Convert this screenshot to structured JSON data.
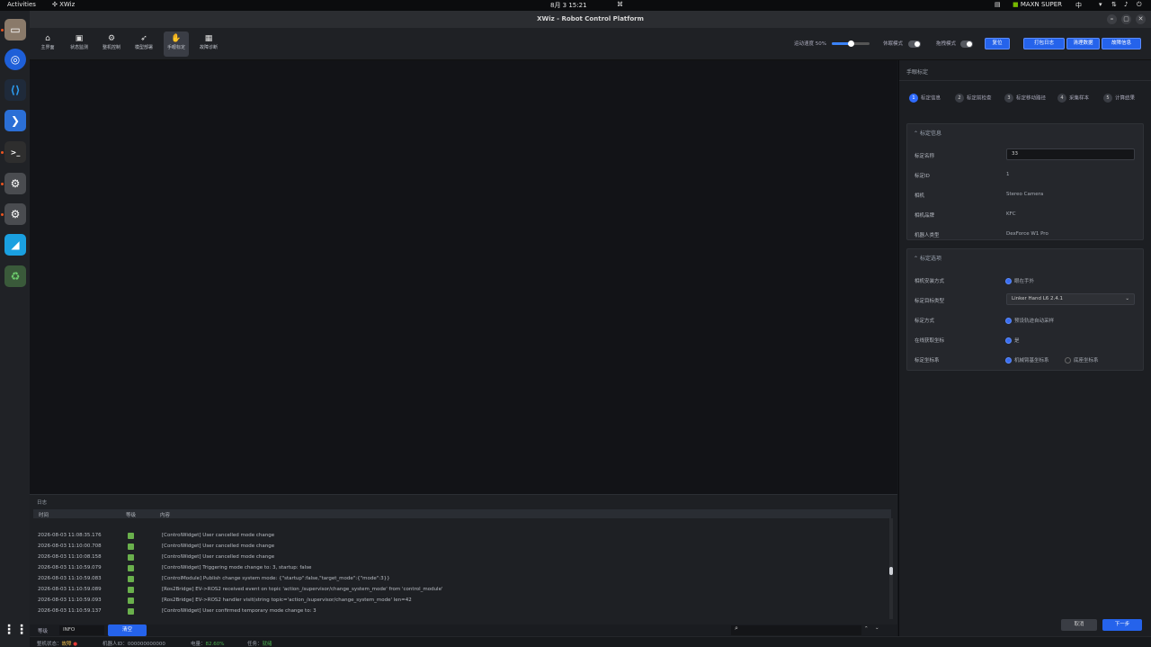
{
  "topbar": {
    "activities": "Activities",
    "app": "XWiz",
    "datetime": "8月 3  15:21",
    "gpu": "MAXN SUPER",
    "lang": "中"
  },
  "window": {
    "title": "XWiz - Robot Control Platform"
  },
  "toolbar": {
    "tools": [
      {
        "label": "主界面",
        "icon": "home-icon"
      },
      {
        "label": "状态监测",
        "icon": "monitor-icon"
      },
      {
        "label": "整机控制",
        "icon": "robot-icon"
      },
      {
        "label": "模型部署",
        "icon": "rocket-icon"
      },
      {
        "label": "手眼标定",
        "icon": "hand-icon"
      },
      {
        "label": "故障诊断",
        "icon": "diagnose-icon"
      }
    ],
    "speed_label": "运动速度 50%",
    "speed_value": 0.5,
    "follow_mode": "休眠模式",
    "drag_mode": "拖拽模式",
    "reset": "复位",
    "open_log": "打包日志",
    "clear_data": "清理数据",
    "fault_info": "故障信息"
  },
  "panel": {
    "title": "手眼标定",
    "steps": [
      "标定信息",
      "标定前检查",
      "标定移动路径",
      "采集样本",
      "计算结果"
    ],
    "info": {
      "header": "标定信息",
      "name_label": "标定名称",
      "name_value": "33",
      "id_label": "标定ID",
      "id_value": "1",
      "camera_label": "相机",
      "camera_value": "Stereo Camera",
      "cam_pos_label": "相机品牌",
      "cam_pos_value": "KFC",
      "robot_label": "机器人类型",
      "robot_value": "DexForce W1 Pro"
    },
    "options": {
      "header": "标定选项",
      "mount_label": "相机安装方式",
      "mount_value": "眼在手外",
      "target_label": "标定目标类型",
      "target_value": "Linker Hand L6 2.4.1",
      "method_label": "标定方式",
      "method_value": "预设轨迹自动采样",
      "online_label": "在线获取坐标",
      "online_value": "是",
      "frame_label": "标定坐标系",
      "frame_opt1": "机械臂基坐标系",
      "frame_opt2": "底座坐标系"
    },
    "cancel": "取消",
    "next": "下一步"
  },
  "log": {
    "title": "日志",
    "col_time": "时间",
    "col_level": "等级",
    "col_content": "内容",
    "rows": [
      {
        "time": "2026-08-03 11:08:35.176",
        "msg": "[ControlWidget] User cancelled mode change"
      },
      {
        "time": "2026-08-03 11:10:00.708",
        "msg": "[ControlWidget] User cancelled mode change"
      },
      {
        "time": "2026-08-03 11:10:08.158",
        "msg": "[ControlWidget] User cancelled mode change"
      },
      {
        "time": "2026-08-03 11:10:59.079",
        "msg": "[ControlWidget] Triggering mode change to: 3, startup: false"
      },
      {
        "time": "2026-08-03 11:10:59.083",
        "msg": "[ControlModule] Publish change system mode: {\"startup\":false,\"target_mode\":{\"mode\":3}}"
      },
      {
        "time": "2026-08-03 11:10:59.089",
        "msg": "[Ros2Bridge] EV->ROS2 received event on topic 'action_/supervisor/change_system_mode' from 'control_module'"
      },
      {
        "time": "2026-08-03 11:10:59.093",
        "msg": "[Ros2Bridge] EV->ROS2 handler visit(string topic='action_/supervisor/change_system_mode' len=42"
      },
      {
        "time": "2026-08-03 11:10:59.137",
        "msg": "[ControlWidget] User confirmed temporary mode change to: 3"
      }
    ],
    "level_label": "等级",
    "level_value": "INFO",
    "clear_btn": "清空"
  },
  "status": {
    "machine_label": "整机状态：",
    "machine_value": "故障",
    "robot_id": "机器人ID：000000000000",
    "battery_label": "电量：",
    "battery_value": "82.60%",
    "task_label": "任务：",
    "task_value": "就绪"
  }
}
